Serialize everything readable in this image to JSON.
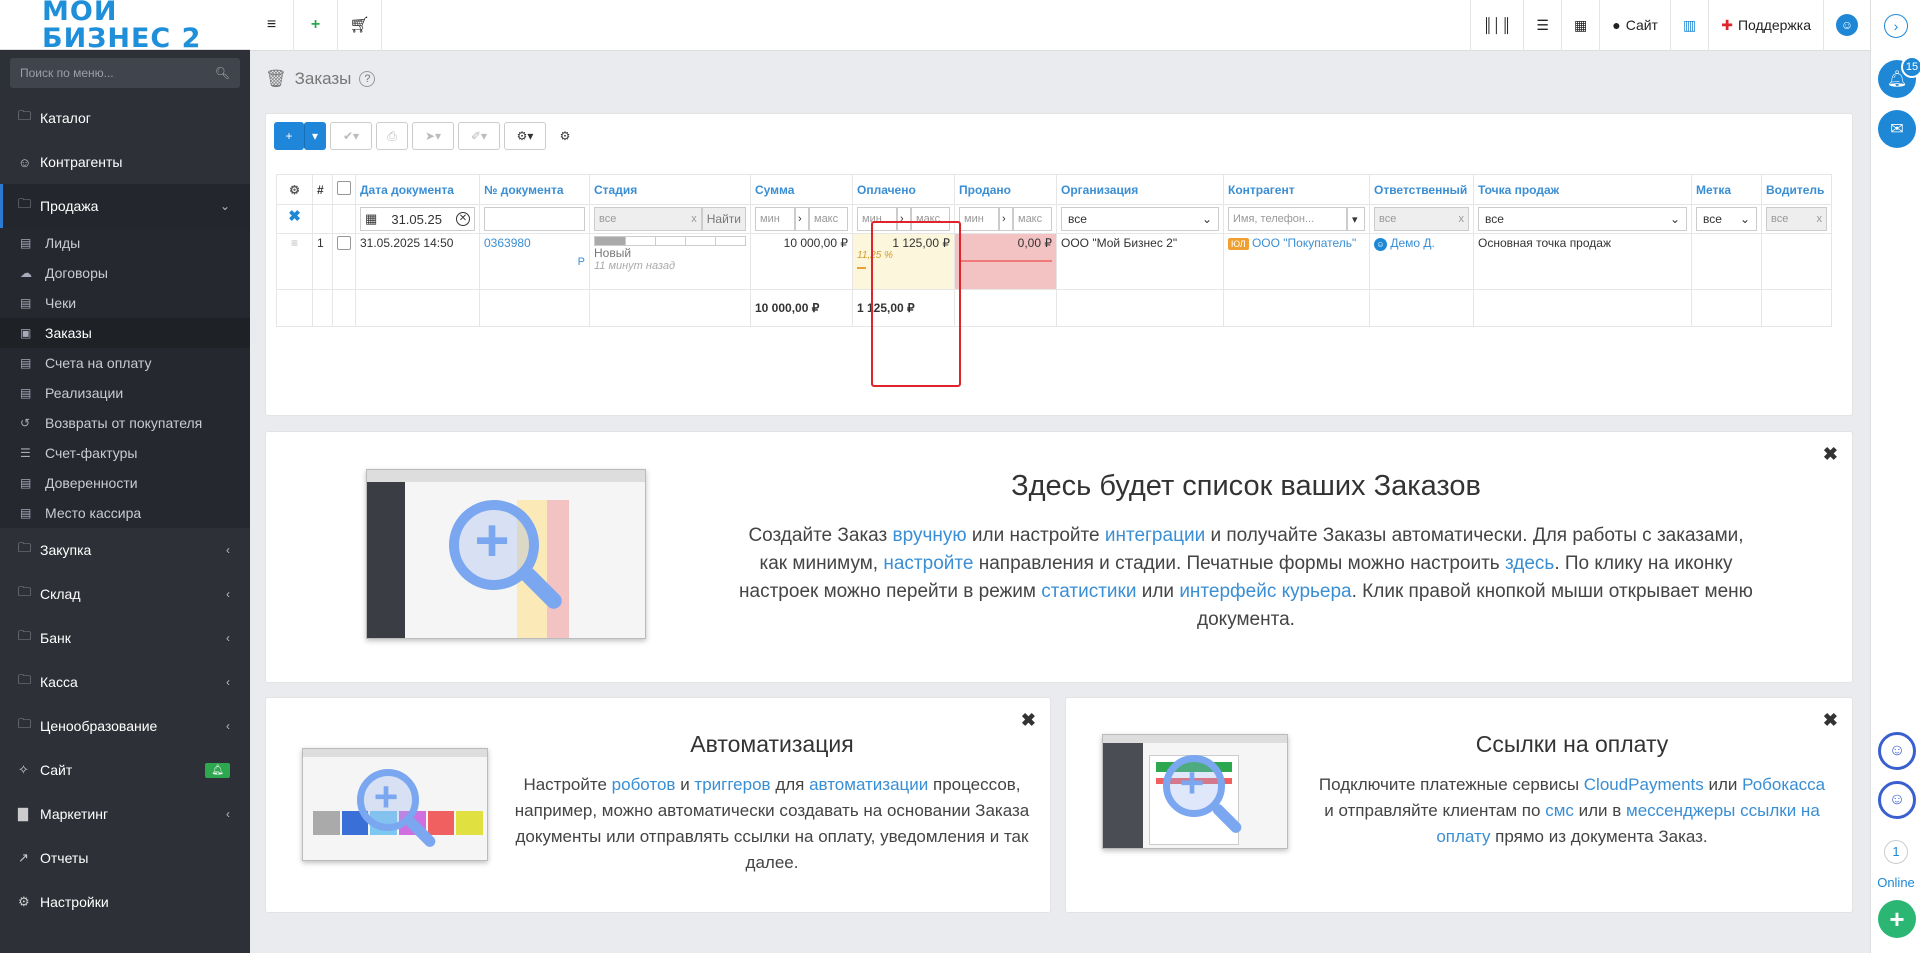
{
  "app": {
    "logo_text": "МОЙ БИЗНЕС 2"
  },
  "sidebar": {
    "search_placeholder": "Поиск по меню...",
    "items": [
      {
        "label": "Каталог",
        "icon": "folder-icon"
      },
      {
        "label": "Контрагенты",
        "icon": "users-icon"
      },
      {
        "label": "Продажа",
        "icon": "folder-icon"
      },
      {
        "label": "Закупка",
        "icon": "folder-icon"
      },
      {
        "label": "Склад",
        "icon": "folder-icon"
      },
      {
        "label": "Банк",
        "icon": "folder-icon"
      },
      {
        "label": "Касса",
        "icon": "folder-icon"
      },
      {
        "label": "Ценообразование",
        "icon": "folder-icon"
      },
      {
        "label": "Сайт",
        "icon": "magic-icon"
      },
      {
        "label": "Маркетинг",
        "icon": "chart-icon"
      },
      {
        "label": "Отчеты",
        "icon": "line-chart-icon"
      },
      {
        "label": "Настройки",
        "icon": "gear-icon"
      }
    ],
    "sub_items": [
      {
        "label": "Лиды"
      },
      {
        "label": "Договоры"
      },
      {
        "label": "Чеки"
      },
      {
        "label": "Заказы"
      },
      {
        "label": "Счета на оплату"
      },
      {
        "label": "Реализации"
      },
      {
        "label": "Возвраты от покупателя"
      },
      {
        "label": "Счет-фактуры"
      },
      {
        "label": "Доверенности"
      },
      {
        "label": "Место кассира"
      }
    ]
  },
  "topbar": {
    "site_label": "Сайт",
    "support_label": "Поддержка"
  },
  "rightbar": {
    "notif_count": "15",
    "online_count": "1",
    "online_label": "Online"
  },
  "page": {
    "title": "Заказы"
  },
  "grid": {
    "headers": [
      "#",
      "Дата документа",
      "№ документа",
      "Стадия",
      "Сумма",
      "Оплачено",
      "Продано",
      "Организация",
      "Контрагент",
      "Ответственный",
      "Точка продаж",
      "Метка",
      "Водитель"
    ],
    "filters": {
      "date": "31.05.25",
      "stage": "все",
      "stage_btn": "Найти",
      "min": "мин",
      "max": "макс",
      "org": "все",
      "contractor_placeholder": "Имя, телефон...",
      "resp": "все",
      "point": "все",
      "tag": "все",
      "driver": "все",
      "clear": "x"
    },
    "row": {
      "num": "1",
      "date": "31.05.2025 14:50",
      "doc": "0363980",
      "doc_sub": "Р",
      "stage": "Новый",
      "stage_time": "11 минут назад",
      "sum": "10 000,00 ₽",
      "paid": "1 125,00 ₽",
      "paid_pct": "11,25 %",
      "sold": "0,00 ₽",
      "org": "ООО \"Мой Бизнес 2\"",
      "contractor_badge": "ЮЛ",
      "contractor": "ООО \"Покупатель\"",
      "resp": "Демо Д.",
      "point": "Основная точка продаж"
    },
    "totals": {
      "sum": "10 000,00 ₽",
      "paid": "1 125,00 ₽"
    }
  },
  "promo_main": {
    "title": "Здесь будет список ваших Заказов",
    "t1": "Создайте Заказ ",
    "l1": "вручную",
    "t2": " или настройте ",
    "l2": "интеграции",
    "t3": " и получайте Заказы автоматически. Для работы с заказами, как минимум, ",
    "l3": "настройте",
    "t4": " направления и стадии. Печатные формы можно настроить ",
    "l4": "здесь",
    "t5": ". По клику на иконку настроек можно перейти в режим ",
    "l5": "статистики",
    "t6": " или ",
    "l6": "интерфейс курьера",
    "t7": ". Клик правой кнопкой мыши открывает меню документа."
  },
  "promo_auto": {
    "title": "Автоматизация",
    "t1": "Настройте ",
    "l1": "роботов",
    "t2": " и ",
    "l2": "триггеров",
    "t3": " для ",
    "l3": "автоматизации",
    "t4": " процессов, например, можно автоматически создавать на основании Заказа документы или отправлять ссылки на оплату, уведомления и так далее."
  },
  "promo_pay": {
    "title": "Ссылки на оплату",
    "t1": "Подключите платежные сервисы ",
    "l1": "CloudPayments",
    "t2": " или ",
    "l2": "Робокасса",
    "t3": " и отправляйте клиентам по ",
    "l3": "смс",
    "t4": " или в ",
    "l4": "мессенджеры",
    "t5": " ",
    "l5": "ссылки на оплату",
    "t6": " прямо из документа Заказ."
  }
}
